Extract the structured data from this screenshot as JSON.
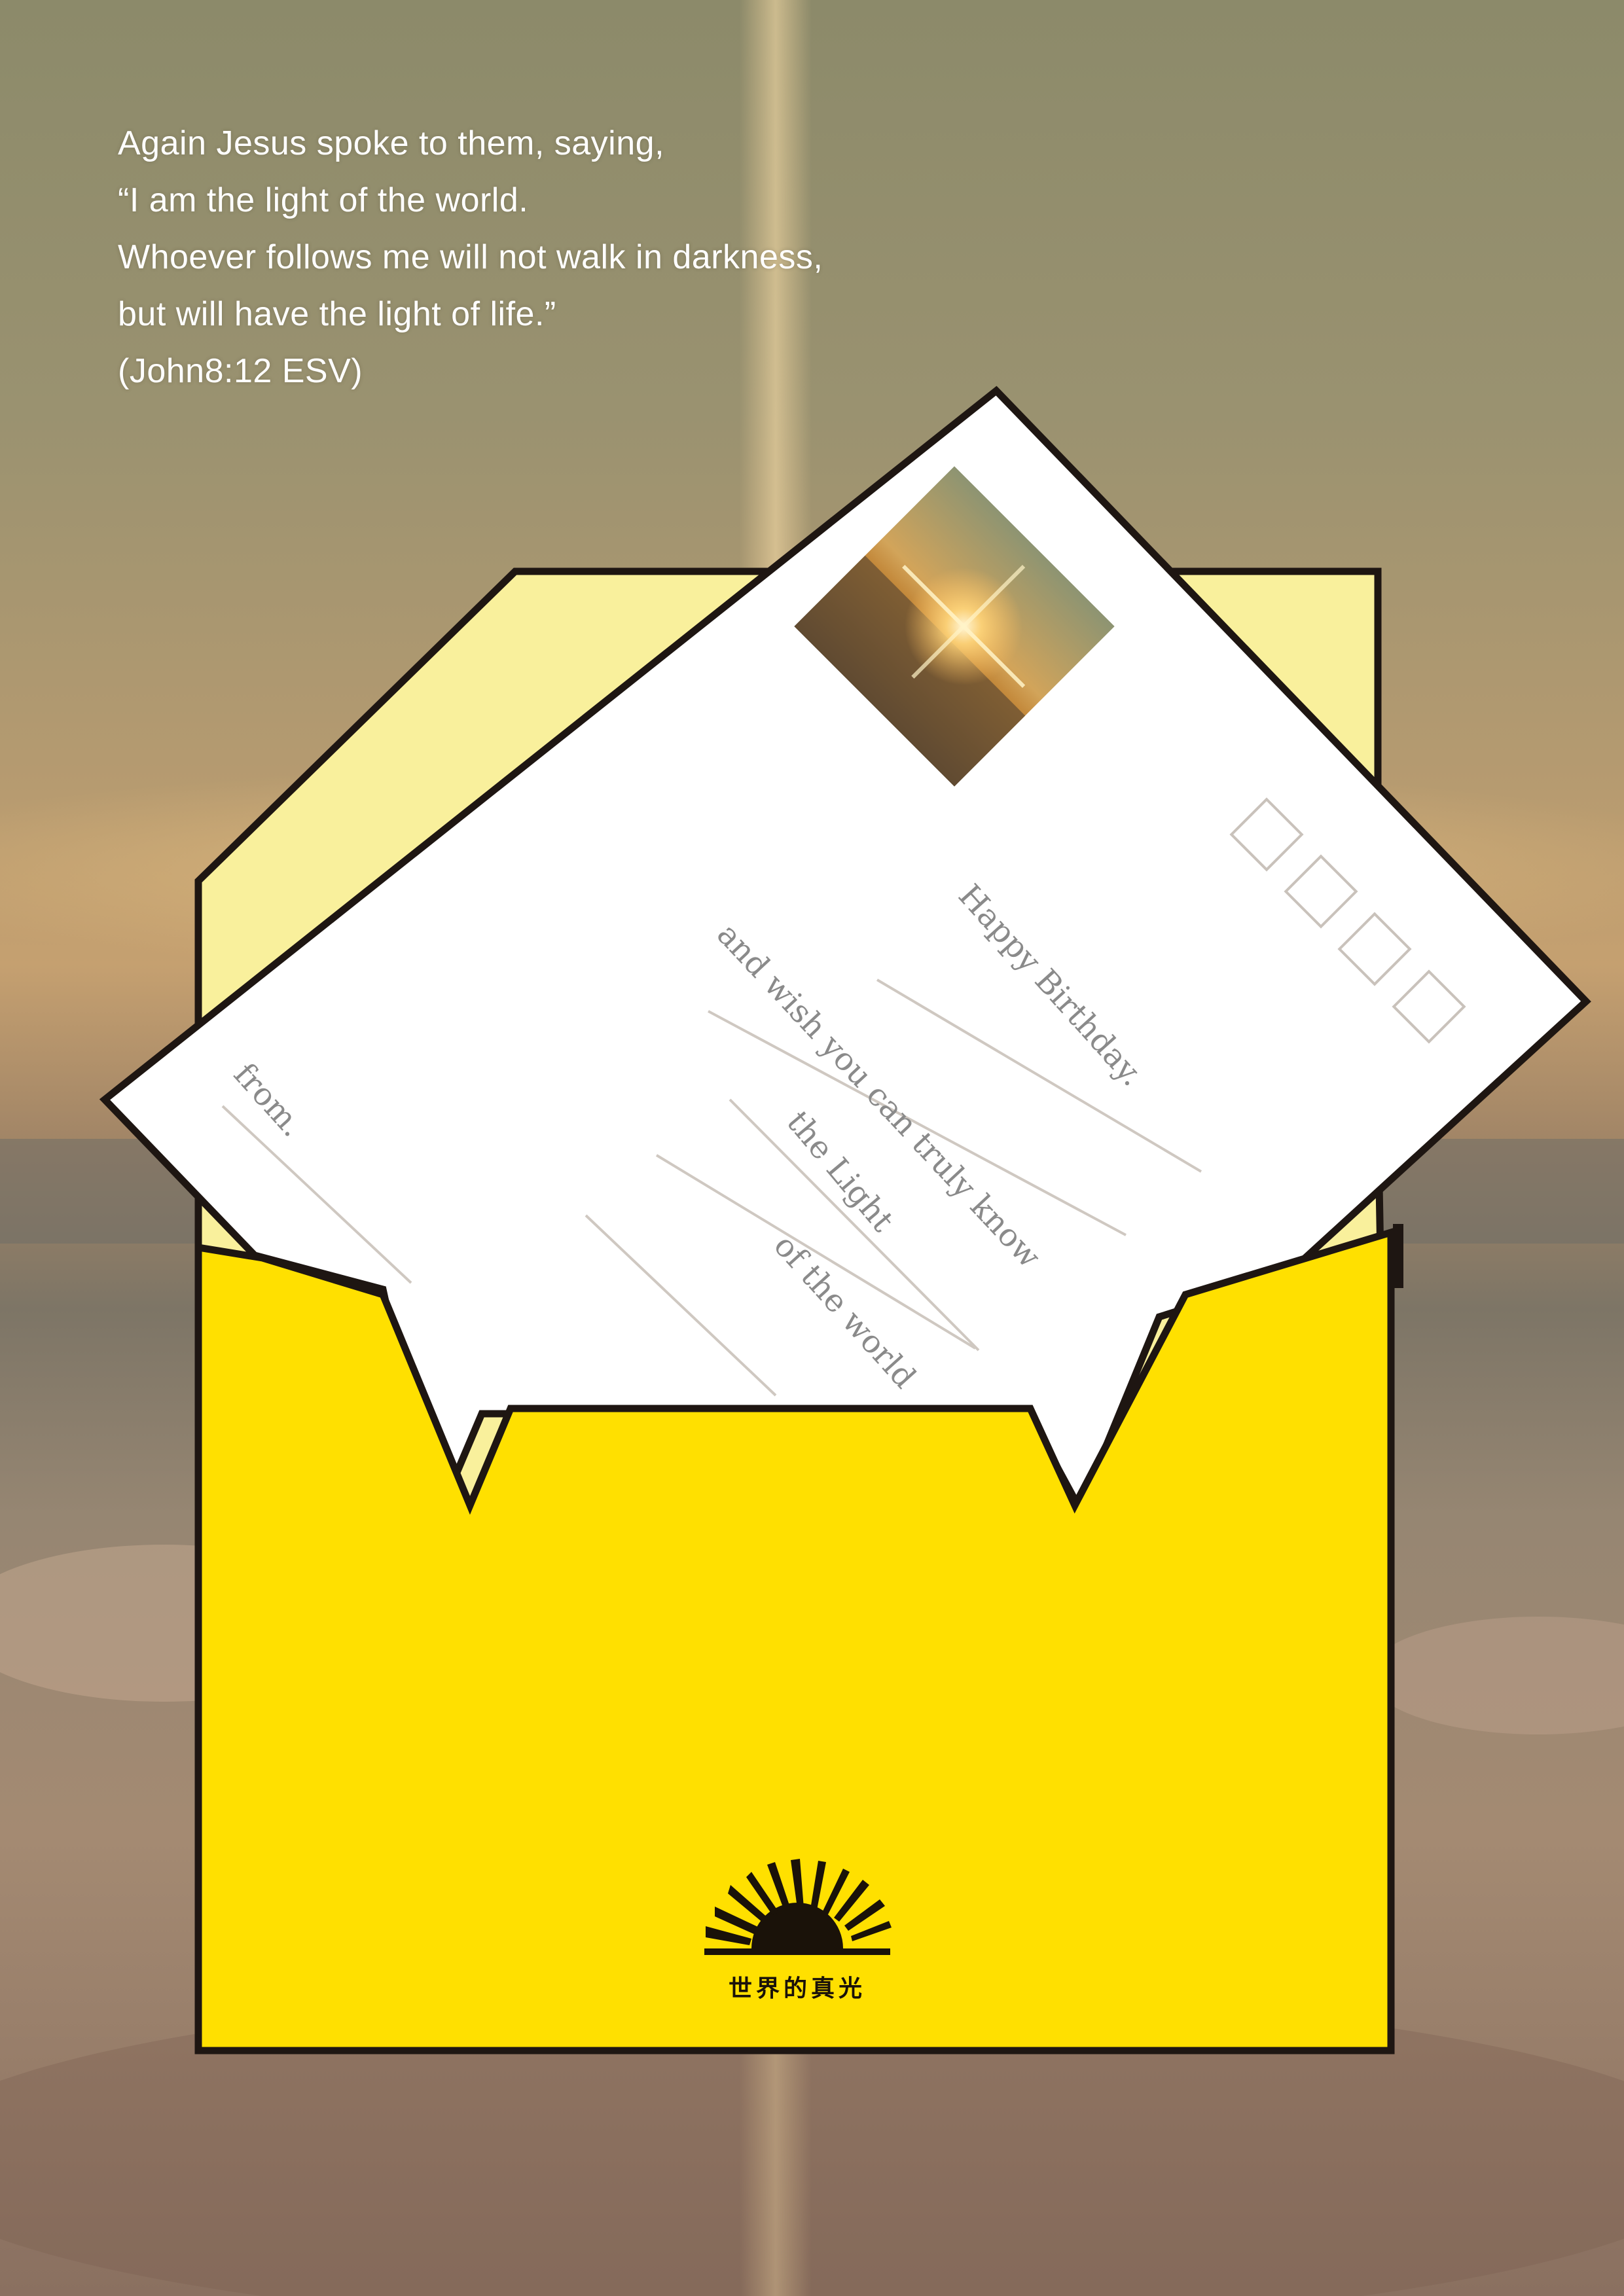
{
  "verse": {
    "lines": [
      "Again Jesus spoke to them, saying,",
      "“I am the light of the world.",
      "Whoever follows me will not walk in darkness,",
      "but will have the light of life.”",
      "(John8:12 ESV)"
    ]
  },
  "card": {
    "greeting": "Happy Birthday.",
    "line2": "and wish you can truly know",
    "line3": "the Light",
    "line4": "of the world",
    "from": "from."
  },
  "logo": {
    "text": "世界的真光"
  },
  "colors": {
    "envelope_front": "#ffe000",
    "envelope_inside": "#f9f09c",
    "outline": "#1e1612",
    "card": "#ffffff",
    "verse_text": "#ffffff"
  },
  "icons": {
    "logo": "rising-sun-icon",
    "stamp": "sunset-photo-stamp"
  }
}
